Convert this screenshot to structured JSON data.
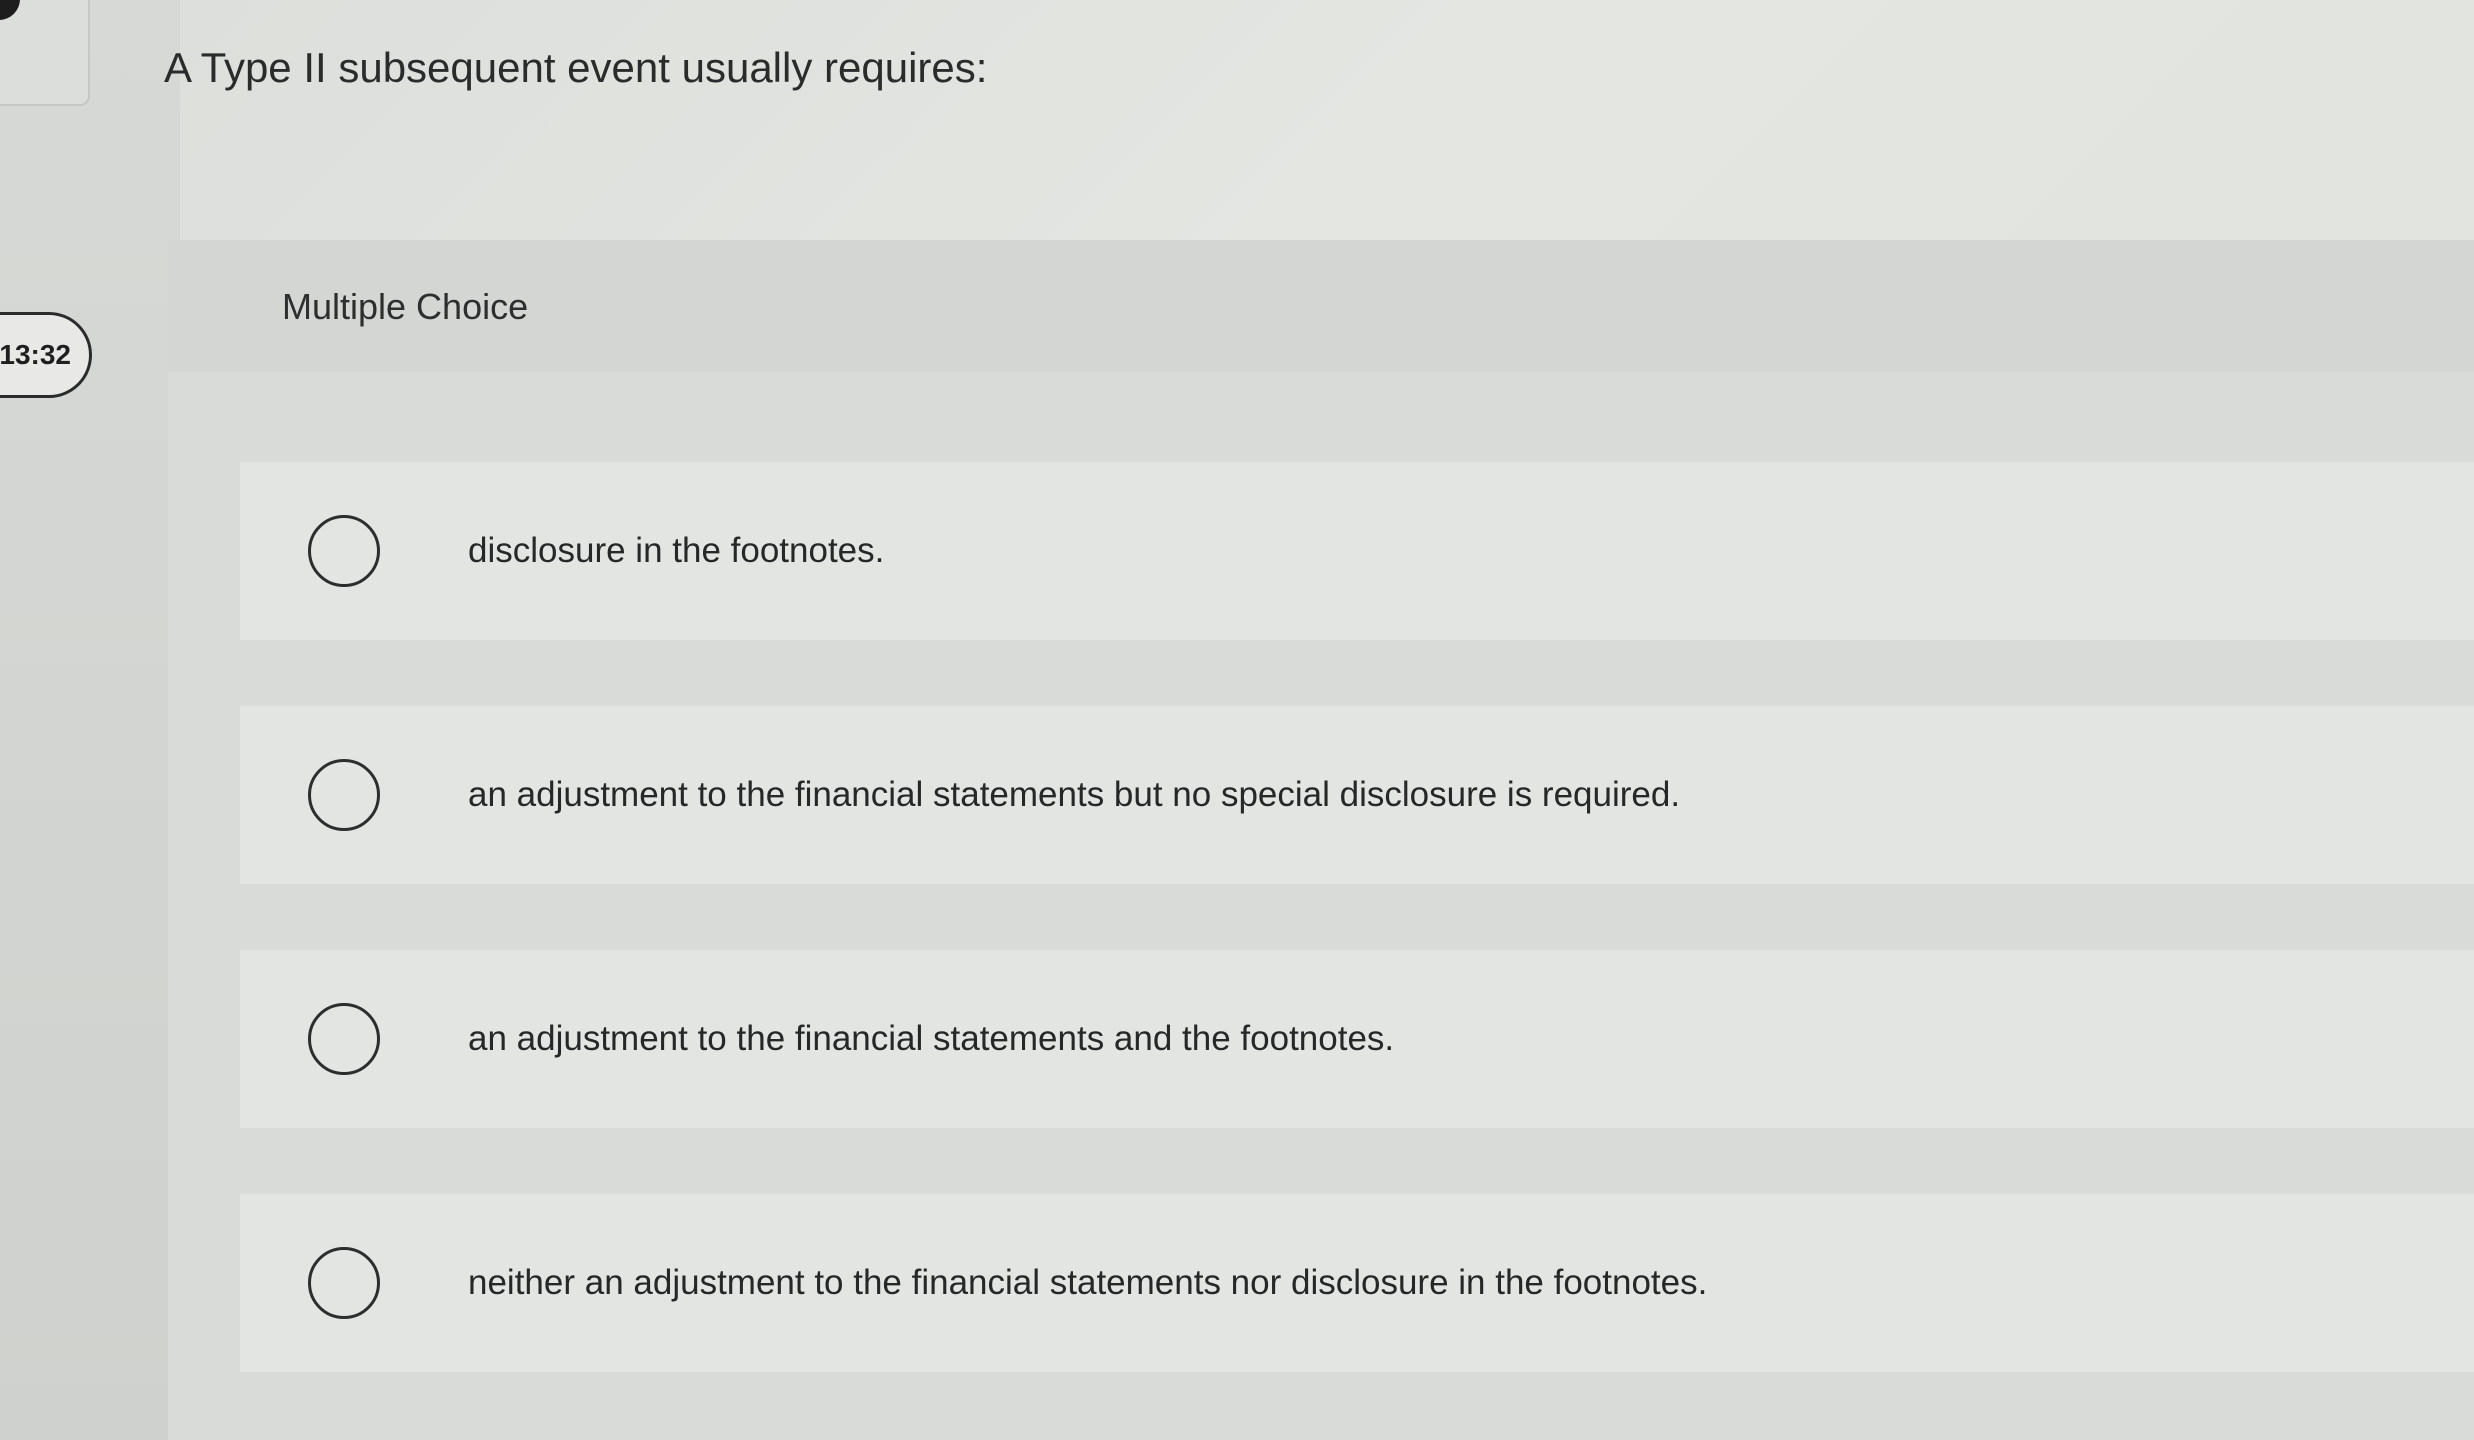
{
  "timer": {
    "text": "13:32"
  },
  "question": {
    "text": "A Type II subsequent event usually requires:"
  },
  "multiple_choice": {
    "title": "Multiple Choice",
    "options": [
      {
        "label": "disclosure in the footnotes."
      },
      {
        "label": "an adjustment to the financial statements but no special disclosure is required."
      },
      {
        "label": "an adjustment to the financial statements and the footnotes."
      },
      {
        "label": "neither an adjustment to the financial statements nor disclosure in the footnotes."
      }
    ]
  }
}
